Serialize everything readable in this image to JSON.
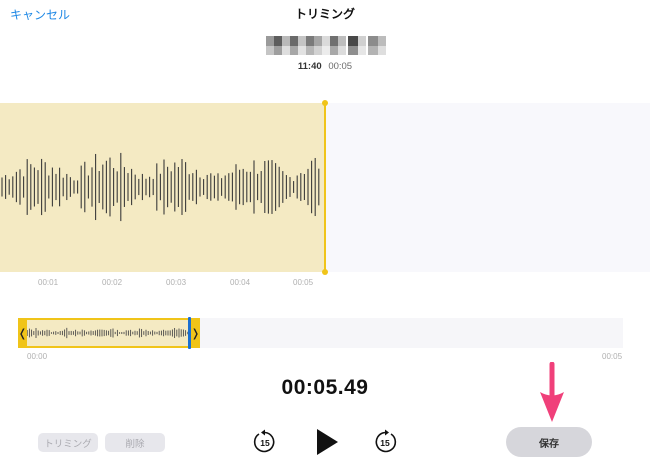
{
  "header": {
    "cancel_label": "キャンセル",
    "title": "トリミング",
    "recording_time": "11:40",
    "recording_duration": "00:05"
  },
  "waveform": {
    "timeline_labels": [
      "00:01",
      "00:02",
      "00:03",
      "00:04",
      "00:05"
    ],
    "selection_color": "#f4eac3",
    "handle_color": "#f0c419"
  },
  "overview": {
    "start_label": "00:00",
    "end_label": "00:05",
    "left_grip_glyph": "❬",
    "right_grip_glyph": "❭",
    "playhead_color": "#1a6fd1"
  },
  "playback": {
    "current_time": "00:05.49",
    "skip_back_seconds": "15",
    "skip_forward_seconds": "15"
  },
  "toolbar": {
    "trim_label": "トリミング",
    "delete_label": "削除",
    "save_label": "保存"
  },
  "annotation": {
    "arrow_color": "#f0407a",
    "arrow_icon": "down-arrow-icon"
  }
}
